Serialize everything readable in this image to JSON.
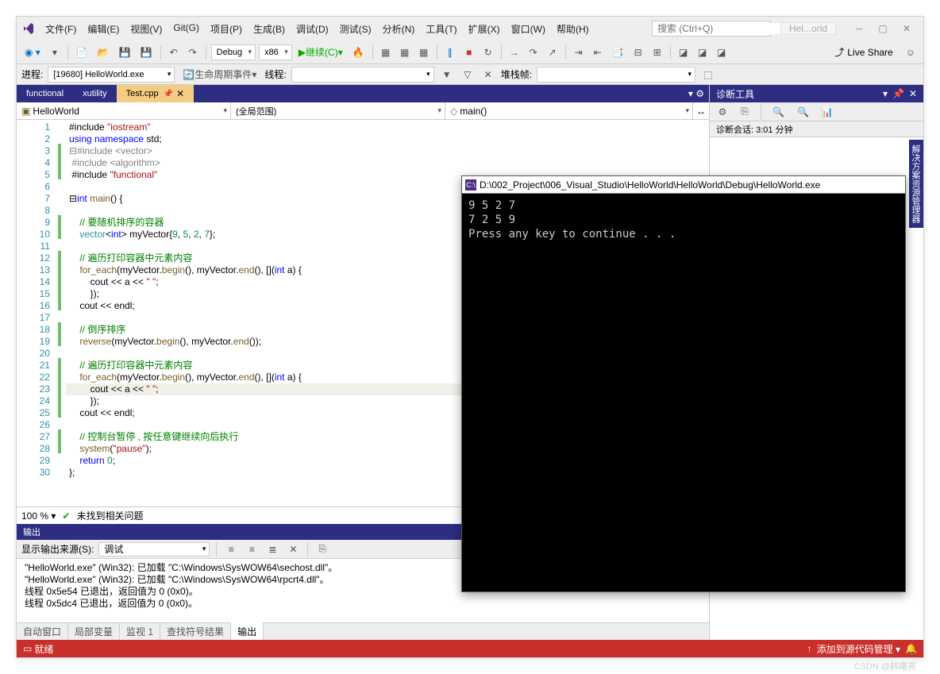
{
  "menu": {
    "file": "文件(F)",
    "edit": "编辑(E)",
    "view": "视图(V)",
    "git": "Git(G)",
    "project": "项目(P)",
    "build": "生成(B)",
    "debug": "调试(D)",
    "test": "测试(S)",
    "analyze": "分析(N)",
    "tools": "工具(T)",
    "extensions": "扩展(X)",
    "window": "窗口(W)",
    "help": "帮助(H)"
  },
  "search": {
    "placeholder": "搜索 (Ctrl+Q)"
  },
  "title_hint": "Hel...orld",
  "toolbar": {
    "config": "Debug",
    "platform": "x86",
    "continue": "继续(C)",
    "live_share": "Live Share"
  },
  "toolbar2": {
    "process_label": "进程:",
    "process": "[19680] HelloWorld.exe",
    "lifecycle": "生命周期事件",
    "thread_label": "线程:",
    "stack_label": "堆栈帧:"
  },
  "tabs": [
    {
      "label": "functional"
    },
    {
      "label": "xutility"
    },
    {
      "label": "Test.cpp",
      "active": true
    }
  ],
  "nav": {
    "project": "HelloWorld",
    "scope": "(全局范围)",
    "member": "main()"
  },
  "code": {
    "lines": [
      {
        "n": 1,
        "html": "#include <span class='str'>\"iostream\"</span>"
      },
      {
        "n": 2,
        "html": "<span class='kw'>using namespace</span> std;"
      },
      {
        "n": 3,
        "mark": "g",
        "html": "<span class='inc'>⊟#include &lt;vector&gt;</span>"
      },
      {
        "n": 4,
        "mark": "g",
        "html": " <span class='inc'>#include &lt;algorithm&gt;</span>"
      },
      {
        "n": 5,
        "mark": "g",
        "html": " #include <span class='str'>\"functional\"</span>"
      },
      {
        "n": 6,
        "html": ""
      },
      {
        "n": 7,
        "html": "⊟<span class='kw'>int</span> <span class='fn'>main</span>() {"
      },
      {
        "n": 8,
        "html": ""
      },
      {
        "n": 9,
        "mark": "g",
        "html": "    <span class='cm'>// 要随机排序的容器</span>"
      },
      {
        "n": 10,
        "mark": "g",
        "html": "    <span class='ty'>vector</span>&lt;<span class='kw'>int</span>&gt; myVector{<span class='num'>9</span>, <span class='num'>5</span>, <span class='num'>2</span>, <span class='num'>7</span>};"
      },
      {
        "n": 11,
        "html": ""
      },
      {
        "n": 12,
        "mark": "g",
        "html": "    <span class='cm'>// 遍历打印容器中元素内容</span>"
      },
      {
        "n": 13,
        "mark": "g",
        "html": "    <span class='fn'>for_each</span>(myVector.<span class='fn'>begin</span>(), myVector.<span class='fn'>end</span>(), [](<span class='kw'>int</span> a) {"
      },
      {
        "n": 14,
        "mark": "g",
        "html": "        cout &lt;&lt; a &lt;&lt; <span class='str'>\" \"</span>;"
      },
      {
        "n": 15,
        "mark": "g",
        "html": "        });"
      },
      {
        "n": 16,
        "mark": "g",
        "html": "    cout &lt;&lt; endl;"
      },
      {
        "n": 17,
        "html": ""
      },
      {
        "n": 18,
        "mark": "g",
        "html": "    <span class='cm'>// 倒序排序</span>"
      },
      {
        "n": 19,
        "mark": "g",
        "html": "    <span class='fn'>reverse</span>(myVector.<span class='fn'>begin</span>(), myVector.<span class='fn'>end</span>());"
      },
      {
        "n": 20,
        "html": ""
      },
      {
        "n": 21,
        "mark": "g",
        "html": "    <span class='cm'>// 遍历打印容器中元素内容</span>"
      },
      {
        "n": 22,
        "mark": "g",
        "html": "    <span class='fn'>for_each</span>(myVector.<span class='fn'>begin</span>(), myVector.<span class='fn'>end</span>(), [](<span class='kw'>int</span> a) {"
      },
      {
        "n": 23,
        "mark": "g",
        "hl": true,
        "html": "        cout &lt;&lt; a &lt;&lt; <span class='str'>\" \"</span>;"
      },
      {
        "n": 24,
        "mark": "g",
        "html": "        });"
      },
      {
        "n": 25,
        "mark": "g",
        "html": "    cout &lt;&lt; endl;"
      },
      {
        "n": 26,
        "html": ""
      },
      {
        "n": 27,
        "mark": "g",
        "html": "    <span class='cm'>// 控制台暂停 , 按任意键继续向后执行</span>"
      },
      {
        "n": 28,
        "mark": "g",
        "html": "    <span class='fn'>system</span>(<span class='str'>\"pause\"</span>);"
      },
      {
        "n": 29,
        "html": "    <span class='kw'>return</span> <span class='num'>0</span>;"
      },
      {
        "n": 30,
        "html": "};"
      }
    ]
  },
  "zoom": {
    "pct": "100 %",
    "issues": "未找到相关问题"
  },
  "output": {
    "title": "输出",
    "source_label": "显示输出来源(S):",
    "source": "调试",
    "lines": [
      "\"HelloWorld.exe\" (Win32): 已加载 \"C:\\Windows\\SysWOW64\\sechost.dll\"。",
      "\"HelloWorld.exe\" (Win32): 已加载 \"C:\\Windows\\SysWOW64\\rpcrt4.dll\"。",
      "线程 0x5e54 已退出，返回值为 0 (0x0)。",
      "线程 0x5dc4 已退出，返回值为 0 (0x0)。"
    ]
  },
  "bottom_tabs": [
    "自动窗口",
    "局部变量",
    "监视 1",
    "查找符号结果",
    "输出"
  ],
  "bottom_active": 4,
  "status": {
    "ready": "就绪",
    "source_control": "添加到源代码管理"
  },
  "diag": {
    "title": "诊断工具",
    "session": "诊断会话: 3:01 分钟"
  },
  "side_tab": "解决方案资源管理器",
  "console": {
    "title": "D:\\002_Project\\006_Visual_Studio\\HelloWorld\\HelloWorld\\Debug\\HelloWorld.exe",
    "body": "9 5 2 7\n7 2 5 9\nPress any key to continue . . ."
  },
  "watermark": "CSDN @韩曙亮"
}
